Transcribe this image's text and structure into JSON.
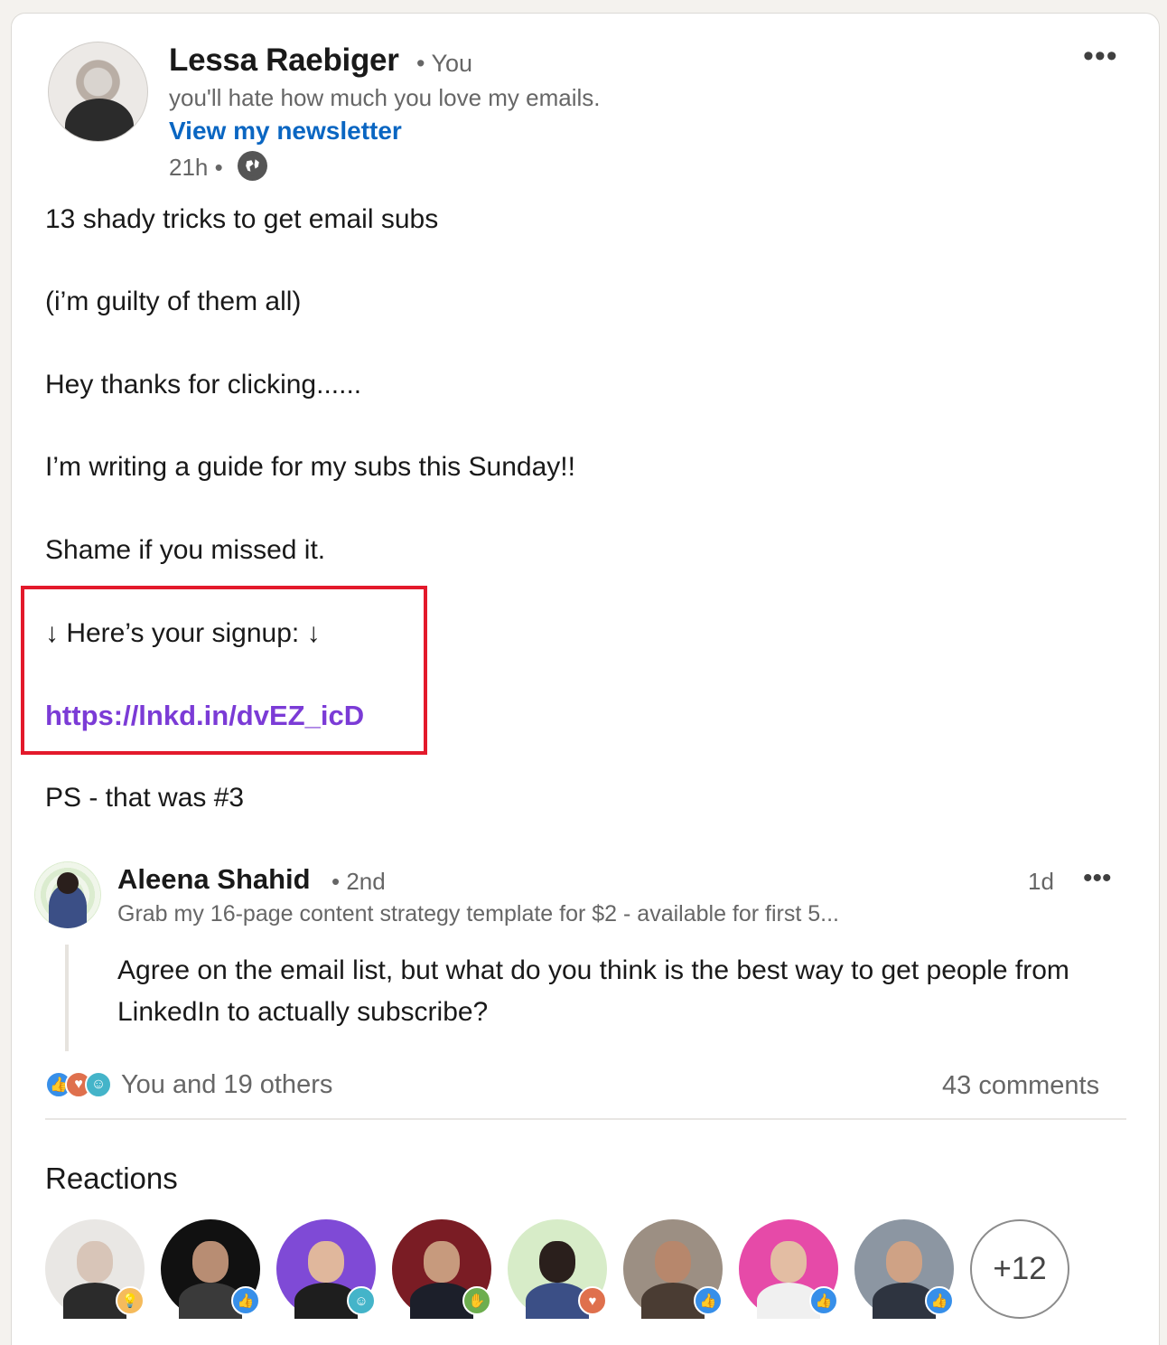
{
  "post": {
    "author_name": "Lessa Raebiger",
    "author_degree": "• You",
    "author_headline": "you'll hate how much you love my emails.",
    "newsletter_link": "View my newsletter",
    "timestamp": "21h •",
    "visibility_icon": "globe-icon",
    "more_icon": "•••",
    "lines": [
      "13 shady tricks to get email subs",
      "(i’m guilty of them all)",
      "Hey thanks for clicking......",
      "I’m writing a guide for my subs this Sunday!!",
      "Shame if you missed it.",
      "↓ Here’s your signup: ↓"
    ],
    "signup_link": "https://lnkd.in/dvEZ_icD",
    "ps_line": "PS - that was #3"
  },
  "highlight_color": "#e3192b",
  "comment": {
    "author_name": "Aleena Shahid",
    "degree": "• 2nd",
    "time": "1d",
    "more_icon": "•••",
    "headline": "Grab my 16-page content strategy template for $2 - available for first 5...",
    "text": "Agree on the email list, but what do you think is the best way to get people from LinkedIn to actually subscribe?"
  },
  "social": {
    "reaction_icons": [
      "like-icon",
      "love-icon",
      "funny-icon"
    ],
    "reaction_summary": "You and 19 others",
    "comments_count": "43 comments"
  },
  "reactions": {
    "title": "Reactions",
    "reactors": [
      {
        "name": "reactor-1",
        "bg": "#e9e7e4",
        "badge": "insightful-icon"
      },
      {
        "name": "reactor-2",
        "bg": "#111111",
        "badge": "like-icon"
      },
      {
        "name": "reactor-3",
        "bg": "#7f4ad6",
        "badge": "funny-icon"
      },
      {
        "name": "reactor-4",
        "bg": "#7a1c24",
        "badge": "support-icon"
      },
      {
        "name": "reactor-5",
        "bg": "#d7ecc8",
        "badge": "love-icon"
      },
      {
        "name": "reactor-6",
        "bg": "#9c8f83",
        "badge": "like-icon"
      },
      {
        "name": "reactor-7",
        "bg": "#e64aa8",
        "badge": "like-icon"
      },
      {
        "name": "reactor-8",
        "bg": "#8c96a2",
        "badge": "like-icon"
      }
    ],
    "more_count": "+12"
  },
  "colors": {
    "link_blue": "#0a66c2",
    "link_purple": "#7b3bd6",
    "secondary_text": "#666666"
  }
}
